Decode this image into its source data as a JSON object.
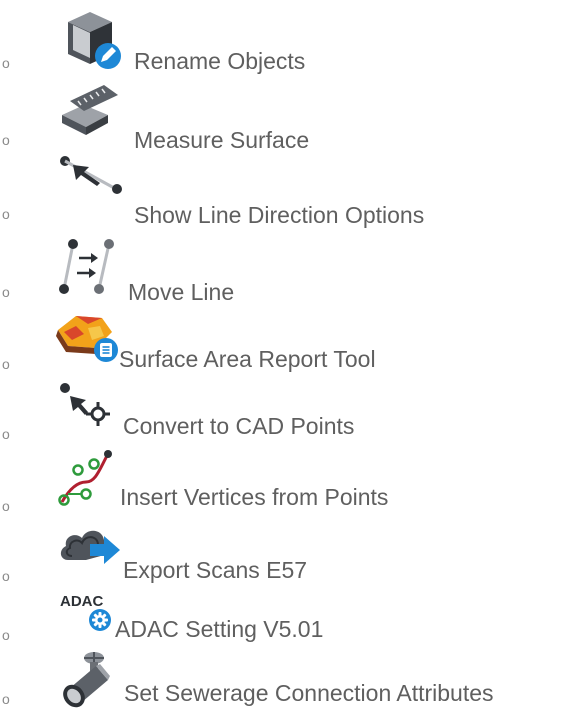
{
  "bullet_glyph": "o",
  "items": [
    {
      "label": "Rename Objects",
      "icon": "cube-pencil-icon"
    },
    {
      "label": "Measure Surface",
      "icon": "ruler-surface-icon"
    },
    {
      "label": "Show Line Direction Options",
      "icon": "line-direction-arrow-icon"
    },
    {
      "label": "Move Line",
      "icon": "move-line-icon"
    },
    {
      "label": "Surface Area Report Tool",
      "icon": "surface-report-icon"
    },
    {
      "label": "Convert to CAD Points",
      "icon": "convert-cad-points-icon"
    },
    {
      "label": "Insert Vertices from Points",
      "icon": "insert-vertices-icon"
    },
    {
      "label": "Export Scans E57",
      "icon": "cloud-export-icon"
    },
    {
      "label": "ADAC Setting V5.01",
      "icon": "adac-gear-icon"
    },
    {
      "label": "Set Sewerage Connection Attributes",
      "icon": "pipe-valve-icon"
    }
  ],
  "colors": {
    "text": "#5f5f5f",
    "bullet": "#8a8a8a",
    "accent_blue": "#1e88d6",
    "icon_gray": "#6b6f75",
    "surface_orange": "#f2a21a",
    "surface_red": "#d9462b"
  }
}
